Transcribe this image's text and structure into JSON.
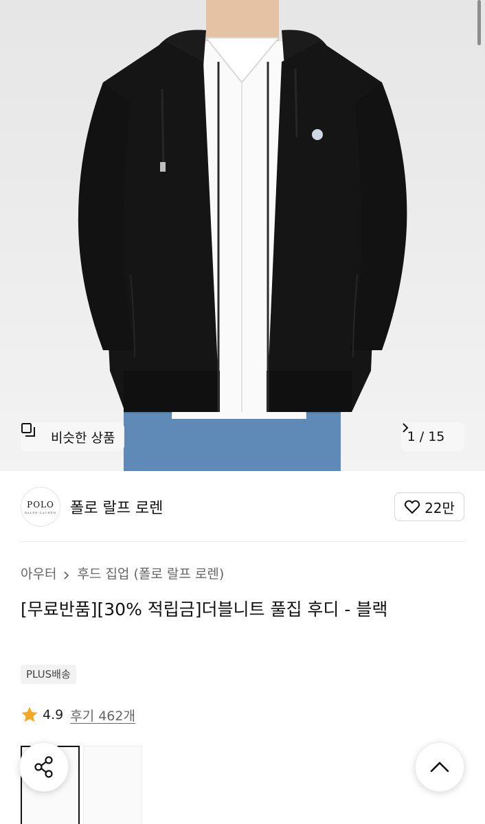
{
  "hero": {
    "similar_label": "비슷한 상품",
    "counter": "1 / 15",
    "icons": {
      "similar": "similar-products-icon",
      "next": "chevron-right-icon"
    }
  },
  "brand": {
    "logo_text": "POLO",
    "logo_subtext": "RALPH LAUREN",
    "name": "폴로 랄프 로렌",
    "likes": "22만"
  },
  "breadcrumb": {
    "items": [
      "아우터",
      "후드 집업 (폴로 랄프 로렌)"
    ]
  },
  "product": {
    "title": "[무료반품][30% 적립금]더블니트 풀집 후디 - 블랙",
    "badge": "PLUS배송",
    "rating": "4.9",
    "reviews": "후기 462개"
  },
  "colors": {
    "star": "#f5a623",
    "text": "#111111",
    "muted": "#666666",
    "badge_bg": "#f2f2f2"
  }
}
